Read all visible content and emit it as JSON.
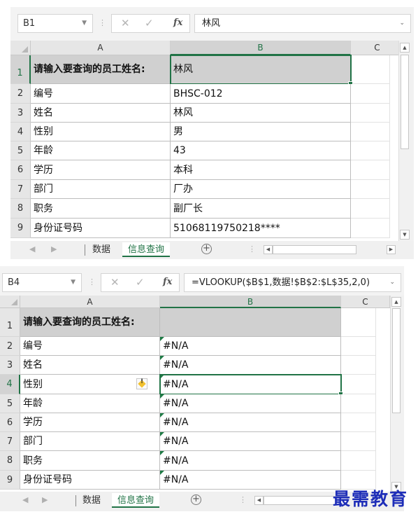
{
  "columns": [
    "A",
    "B",
    "C"
  ],
  "row_numbers": [
    "1",
    "2",
    "3",
    "4",
    "5",
    "6",
    "7",
    "8",
    "9"
  ],
  "labels": [
    "请输入要查询的员工姓名:",
    "编号",
    "姓名",
    "性别",
    "年龄",
    "学历",
    "部门",
    "职务",
    "身份证号码"
  ],
  "icons": {
    "cancel": "✕",
    "confirm": "✓",
    "fx": "fx",
    "dropdown": "chevron-down-icon",
    "error_indicator": "warning-diamond-icon"
  },
  "top": {
    "name_box": "B1",
    "formula": "林风",
    "values": [
      "林风",
      "BHSC-012",
      "林风",
      "男",
      "43",
      "本科",
      "厂办",
      "副厂长",
      "51068119750218****"
    ],
    "tabs": [
      "数据",
      "信息查询"
    ],
    "active_tab": "信息查询"
  },
  "bottom": {
    "name_box": "B4",
    "formula": "=VLOOKUP($B$1,数据!$B$2:$L$35,2,0)",
    "values": [
      "",
      "#N/A",
      "#N/A",
      "#N/A",
      "#N/A",
      "#N/A",
      "#N/A",
      "#N/A",
      "#N/A"
    ],
    "tabs": [
      "数据",
      "信息查询"
    ],
    "active_tab": "信息查询"
  },
  "colors": {
    "excel_green": "#217346",
    "header_fill": "#d0d0d0",
    "watermark": "#1e2eb8"
  },
  "watermark": "最需教育"
}
